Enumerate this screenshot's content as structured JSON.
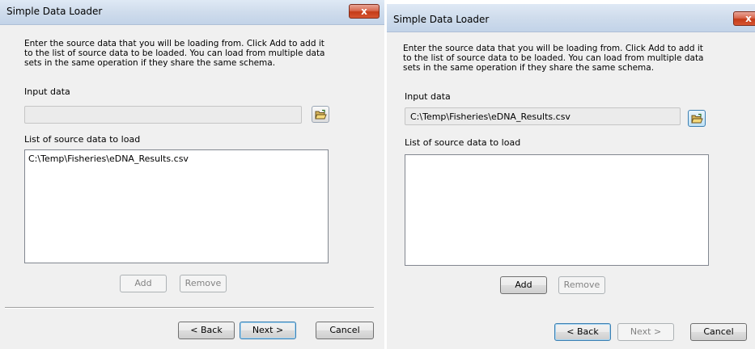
{
  "dialogs": [
    {
      "title": "Simple Data Loader",
      "close_glyph": "x",
      "description": "Enter the source data that you will be loading from. Click Add to add it to the list of source data to be loaded. You can load from multiple data sets in the same operation if they share the same schema.",
      "input_label": "Input data",
      "input_value": "",
      "list_label": "List of source data to load",
      "list_items": [
        "C:\\Temp\\Fisheries\\eDNA_Results.csv"
      ],
      "add_label": "Add",
      "remove_label": "Remove",
      "back_label": "< Back",
      "next_label": "Next >",
      "cancel_label": "Cancel"
    },
    {
      "title": "Simple Data Loader",
      "close_glyph": "x",
      "description": "Enter the source data that you will be loading from. Click Add to add it to the list of source data to be loaded. You can load from multiple data sets in the same operation if they share the same schema.",
      "input_label": "Input data",
      "input_value": "C:\\Temp\\Fisheries\\eDNA_Results.csv",
      "list_label": "List of source data to load",
      "list_items": [],
      "add_label": "Add",
      "remove_label": "Remove",
      "back_label": "< Back",
      "next_label": "Next >",
      "cancel_label": "Cancel"
    }
  ],
  "icons": {
    "folder": "folder-open-icon",
    "close": "close-icon"
  },
  "colors": {
    "titlebar": "#cfdcec",
    "close_button": "#c43b18",
    "dialog_bg": "#f0f0f0",
    "default_button_border": "#3c7fb1"
  }
}
